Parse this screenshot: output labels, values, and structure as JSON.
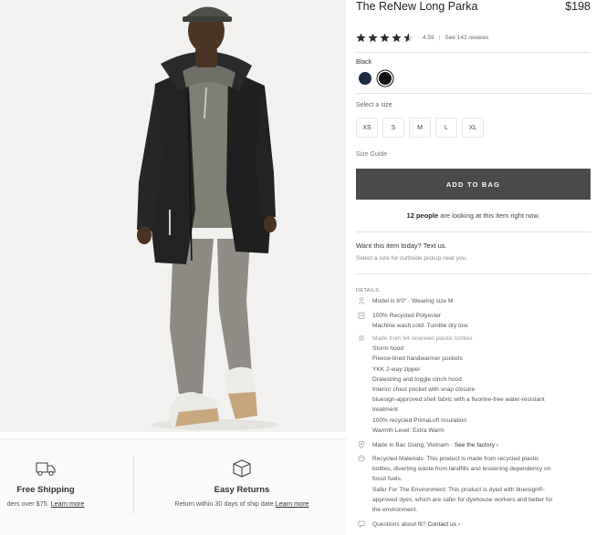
{
  "product": {
    "name": "The ReNew Long Parka",
    "price": "$198",
    "rating": "4.59",
    "rating_sep": "|",
    "reviews_link": "See 143 reviews",
    "stars": [
      1,
      1,
      1,
      1,
      0.5
    ]
  },
  "colors": {
    "label": "Black",
    "swatches": [
      {
        "name": "navy",
        "hex": "#1f2a44"
      },
      {
        "name": "black",
        "hex": "#111111",
        "selected": true
      }
    ]
  },
  "sizes": {
    "label": "Select a size",
    "options": [
      "XS",
      "S",
      "M",
      "L",
      "XL"
    ],
    "guide": "Size Guide"
  },
  "cta": {
    "add_to_bag": "ADD TO BAG",
    "watchers_count": "12 people",
    "watchers_text": " are looking at this item right now."
  },
  "pickup": {
    "title": "Want this item today? Text us.",
    "subtitle": "Select a size for curbside pickup near you."
  },
  "details": {
    "label": "DETAILS",
    "model": [
      "Model is 6'0\"  ·  Wearing size M"
    ],
    "care": [
      "100% Recycled Polyester",
      "Machine wash cold. Tumble dry low."
    ],
    "features": [
      "Made from 64 renewed plastic bottles",
      "Storm hood",
      "Fleece-lined handwarmer pockets",
      "YKK 2-way zipper",
      "Drawstring and toggle cinch hood",
      "Interior chest pocket with snap closure",
      "bluesign-approved shell fabric with a fluorine-free water-resistant",
      "treatment",
      "100% recycled PrimaLoft insulation",
      "Warmth Level: Extra Warm"
    ],
    "origin_text": "Made in Bac Giang, Vietnam  ·  ",
    "origin_link": "See the factory ›",
    "materials": [
      "Recycled Materials: This product is made from recycled plastic",
      "bottles, diverting waste from landfills and lessening dependency on",
      "fossil fuels.",
      "Safer For The Environment: This product is dyed with bluesign®-",
      "approved dyes, which are safer for dyehouse workers and better for",
      "the environment."
    ],
    "fit_text": "Questions about fit? ",
    "fit_link": "Contact us ›"
  },
  "perks": [
    {
      "icon": "truck-icon",
      "title": "Free Shipping",
      "text": "ders over $75. ",
      "link": "Learn more"
    },
    {
      "icon": "box-icon",
      "title": "Easy Returns",
      "text": "Return within 30 days of ship date.",
      "link": "Learn more"
    }
  ],
  "colors_theme": {
    "button_bg": "#4a4a4a",
    "star": "#2b2b2b",
    "background": "#f1f0ee"
  }
}
